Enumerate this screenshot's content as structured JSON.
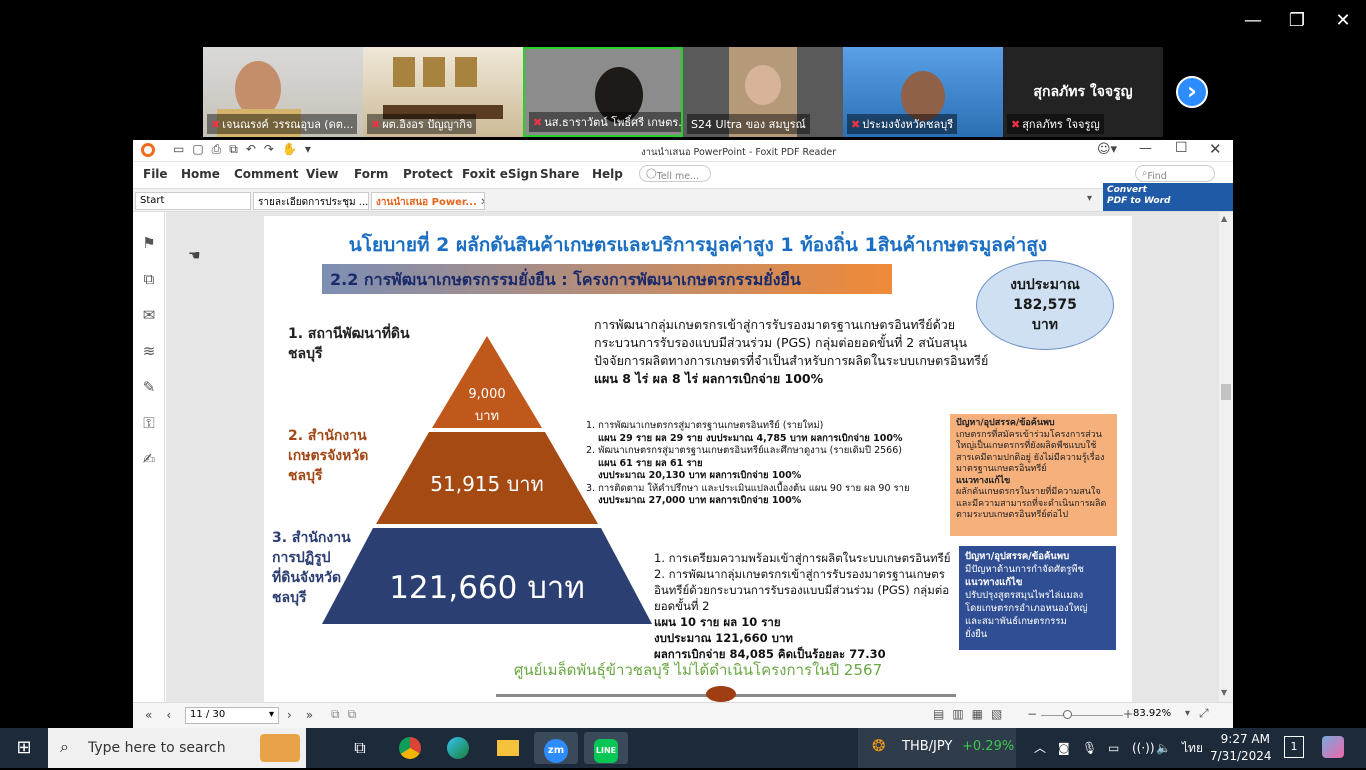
{
  "zoom": {
    "window_controls": {
      "minimize": "—",
      "restore": "❐",
      "close": "✕"
    },
    "next_arrow": "›",
    "participants": [
      {
        "name": "เจนณรงค์ วรรณอุบล (ดต..."
      },
      {
        "name": "ผต.อิงอร  ปัญญากิจ"
      },
      {
        "name": "นส.ธาราวัตน์ โพธิ์ศรี เกษตร..."
      },
      {
        "name": "S24 Ultra ของ สมบูรณ์"
      },
      {
        "name": "ประมงจังหวัดชลบุรี"
      },
      {
        "name": "สุกลภัทร ใจจรูญ",
        "big_name": "สุกลภัทร ใจจรูญ"
      }
    ]
  },
  "foxit": {
    "title": "งานนำเสนอ PowerPoint - Foxit PDF Reader",
    "menu": [
      "File",
      "Home",
      "Comment",
      "View",
      "Form",
      "Protect",
      "Foxit eSign",
      "Share",
      "Help"
    ],
    "tell_me_placeholder": "Tell me...",
    "find_placeholder": "Find",
    "tabs": {
      "start": "Start",
      "tab1": "รายละเอียดการประชุม ...",
      "tab2": "งานนำเสนอ Power..."
    },
    "convert_label_1": "Convert",
    "convert_label_2": "PDF to Word",
    "status": {
      "page": "11 / 30",
      "zoom": "83.92%"
    }
  },
  "slide": {
    "title": "นโยบายที่ 2 ผลักดันสินค้าเกษตรและบริการมูลค่าสูง 1 ท้องถิ่น 1สินค้าเกษตรมูลค่าสูง",
    "subtitle": "2.2 การพัฒนาเกษตรกรรมยั่งยืน : โครงการพัฒนาเกษตรกรรมยั่งยืน",
    "budget": {
      "l1": "งบประมาณ",
      "l2": "182,575",
      "l3": "บาท"
    },
    "levels": {
      "l1": [
        "1. สถานีพัฒนาที่ดิน",
        "ชลบุรี"
      ],
      "l2": [
        "2. สำนักงาน",
        "เกษตรจังหวัด",
        "ชลบุรี"
      ],
      "l3": [
        "3. สำนักงาน",
        "การปฏิรูป",
        "ที่ดินจังหวัด",
        "ชลบุรี"
      ]
    },
    "pyramid": {
      "top_amount": "9,000",
      "top_unit": "บาท",
      "mid": "51,915 บาท",
      "bottom": "121,660 บาท"
    },
    "text1": [
      "การพัฒนากลุ่มเกษตรกรเข้าสู่การรับรองมาตรฐานเกษตรอินทรีย์ด้วย",
      "กระบวนการรับรองแบบมีส่วนร่วม (PGS) กลุ่มต่อยอดขั้นที่ 2 สนับสนุน",
      "ปัจจัยการผลิตทางการเกษตรที่จำเป็นสำหรับการผลิตในระบบเกษตรอินทรีย์",
      "แผน 8 ไร่ ผล 8 ไร่ ผลการเบิกจ่าย 100%"
    ],
    "text2": [
      "1. การพัฒนาเกษตรกรสู่มาตรฐานเกษตรอินทรีย์ (รายใหม่)",
      "แผน 29 ราย ผล 29 ราย งบประมาณ 4,785 บาท ผลการเบิกจ่าย 100%",
      "2. พัฒนาเกษตรกรสู่มาตรฐานเกษตรอินทรีย์และศึกษาดูงาน (รายเดิมปี 2566)",
      "แผน 61 ราย ผล 61 ราย",
      "งบประมาณ 20,130 บาท ผลการเบิกจ่าย 100%",
      "3. การติดตาม ให้คำปรึกษา และประเมินแปลงเบื้องต้น แผน 90 ราย ผล 90 ราย",
      "งบประมาณ 27,000 บาท ผลการเบิกจ่าย 100%"
    ],
    "text3": [
      "1. การเตรียมความพร้อมเข้าสู่การผลิตในระบบเกษตรอินทรีย์",
      "2. การพัฒนากลุ่มเกษตรกรเข้าสู่การรับรองมาตรฐานเกษตร",
      "อินทรีย์ด้วยกระบวนการรับรองแบบมีส่วนร่วม (PGS) กลุ่มต่อ",
      "ยอดขั้นที่ 2",
      "แผน 10 ราย ผล 10 ราย",
      "งบประมาณ 121,660 บาท",
      "ผลการเบิกจ่าย 84,085 คิดเป็นร้อยละ 77.30"
    ],
    "box1": [
      "ปัญหา/อุปสรรค/ข้อค้นพบ",
      "เกษตรกรที่สมัครเข้าร่วมโครงการส่วน",
      "ใหญ่เป็นเกษตรกรที่ยังผลิตพืชแบบใช้",
      "สารเคมีตามปกติอยู่ ยังไม่มีความรู้เรื่อง",
      "มาตรฐานเกษตรอินทรีย์",
      "แนวทางแก้ไข",
      "ผลักดันเกษตรกรในรายที่มีความสนใจ",
      "และมีความสามารถที่จะดำเนินการผลิต",
      "ตามระบบเกษตรอินทรีย์ต่อไป"
    ],
    "box2": [
      "ปัญหา/อุปสรรค/ข้อค้นพบ",
      "มีปัญหาด้านการกำจัดศัตรูพืช",
      "แนวทางแก้ไข",
      "ปรับปรุงสูตรสมุนไพรไล่แมลง",
      "โดยเกษตรกรอำเภอหนองใหญ่",
      "และสมาพันธ์เกษตรกรรม",
      "ยั่งยืน"
    ],
    "footer": "ศูนย์เมล็ดพันธุ์ข้าวชลบุรี ไม่ได้ดำเนินโครงการในปี 2567"
  },
  "taskbar": {
    "search_placeholder": "Type here to search",
    "currency": "THB/JPY",
    "currency_change": "+0.29%",
    "lang": "ไทย",
    "time": "9:27 AM",
    "date": "7/31/2024",
    "notif_count": "1"
  },
  "colors": {
    "pyr_top": "#c0581c",
    "pyr_mid": "#a44a12",
    "pyr_bottom": "#2c3f72",
    "title_blue": "#1b6fc2"
  }
}
